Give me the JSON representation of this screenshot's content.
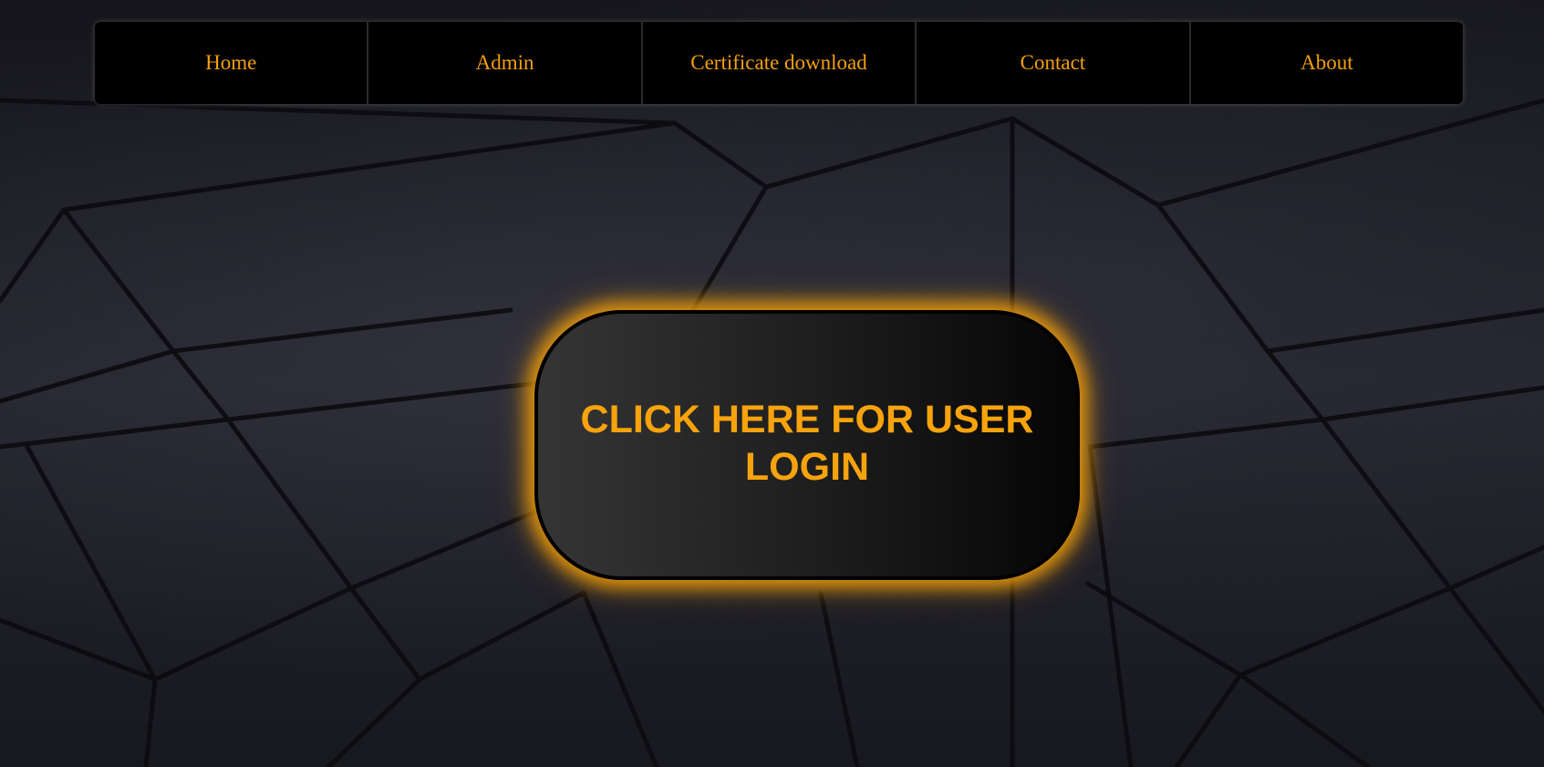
{
  "nav": {
    "items": [
      {
        "label": "Home"
      },
      {
        "label": "Admin"
      },
      {
        "label": "Certificate download"
      },
      {
        "label": "Contact"
      },
      {
        "label": "About"
      }
    ]
  },
  "main": {
    "login_button_label": "CLICK HERE FOR USER LOGIN"
  },
  "colors": {
    "accent": "#f4a00c",
    "nav_background": "#000000",
    "page_background": "#1b1b22"
  }
}
